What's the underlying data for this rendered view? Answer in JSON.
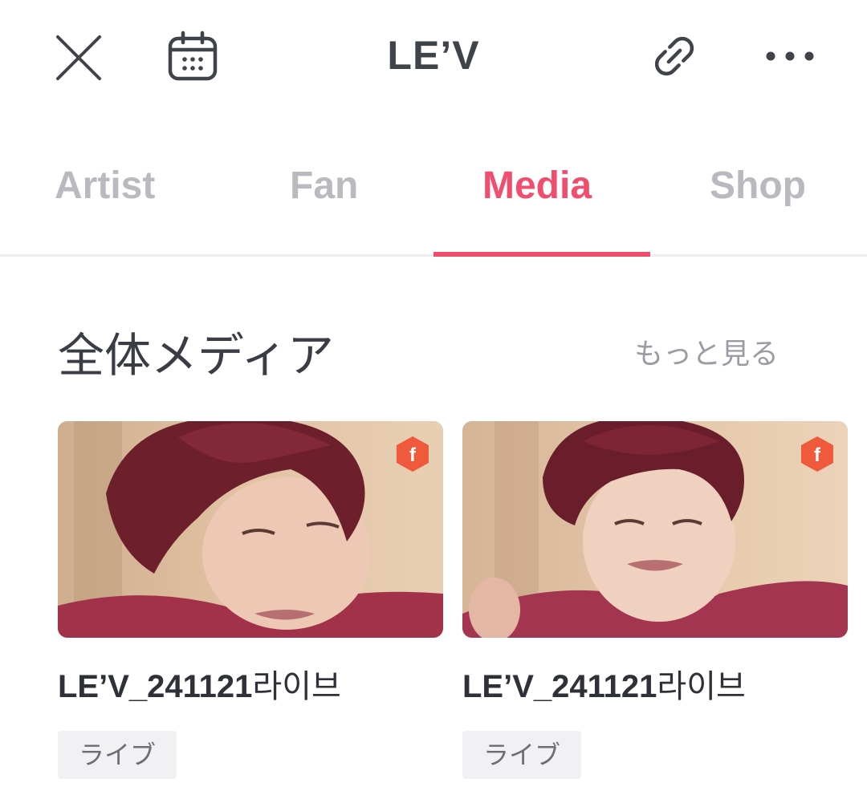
{
  "header": {
    "title": "LE’V",
    "icons": [
      "close-icon",
      "calendar-icon",
      "link-icon",
      "more-icon"
    ]
  },
  "tabs": [
    {
      "label": "Artist",
      "active": false
    },
    {
      "label": "Fan",
      "active": false
    },
    {
      "label": "Media",
      "active": true
    },
    {
      "label": "Shop",
      "active": false
    }
  ],
  "section": {
    "title": "全体メディア",
    "more_label": "もっと見る"
  },
  "cards": [
    {
      "title_prefix": "LE’V_241121",
      "title_suffix": "라이브",
      "tag": "ライブ",
      "badge_letter": "f",
      "badge_icon": "fanclub-badge-icon"
    },
    {
      "title_prefix": "LE’V_241121",
      "title_suffix": "라이브",
      "tag": "ライブ",
      "badge_letter": "f",
      "badge_icon": "fanclub-badge-icon"
    }
  ],
  "colors": {
    "accent": "#f14d6e",
    "tab_inactive": "#b8babf",
    "badge": "#f05a3c"
  }
}
